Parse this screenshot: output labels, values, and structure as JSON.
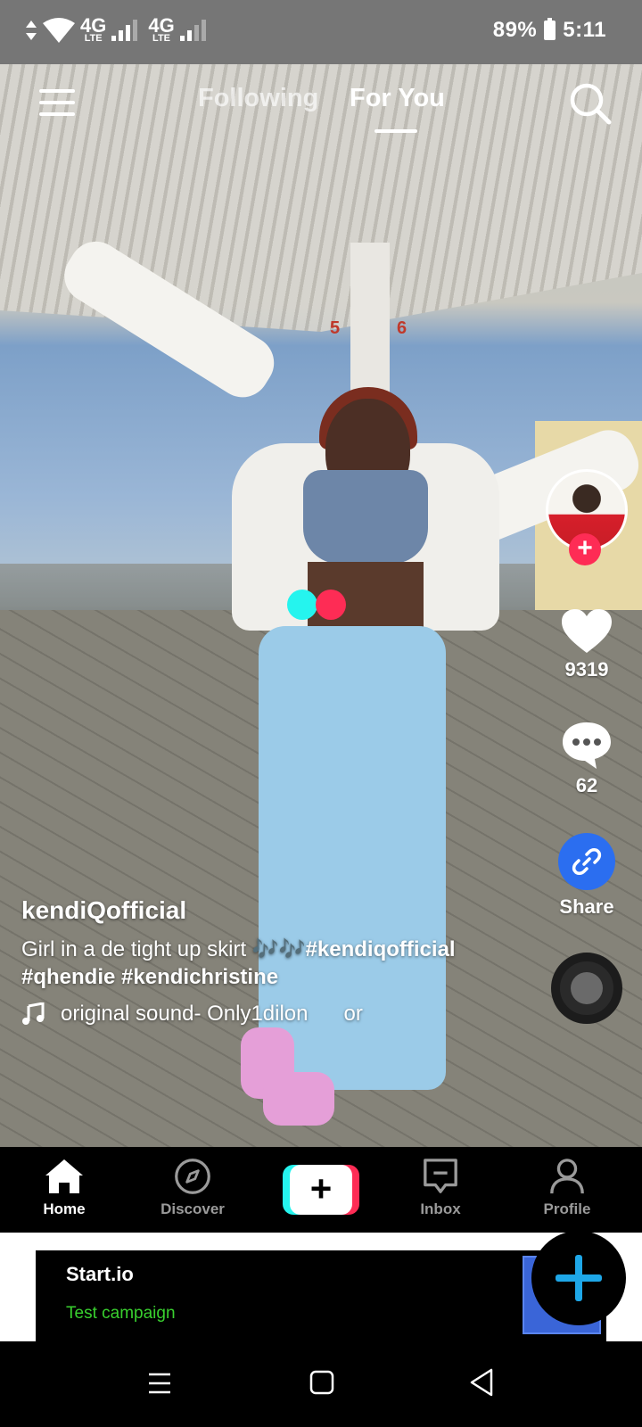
{
  "status_bar": {
    "network_1": "4G",
    "network_1_sub": "LTE",
    "network_2": "4G",
    "network_2_sub": "LTE",
    "battery": "89%",
    "time": "5:11"
  },
  "top_nav": {
    "tabs": [
      {
        "label": "Following",
        "active": false
      },
      {
        "label": "For You",
        "active": true
      }
    ],
    "menu_icon": "hamburger-icon",
    "search_icon": "search-icon"
  },
  "video": {
    "pump_labels": [
      "5",
      "6"
    ]
  },
  "side_actions": {
    "likes": "9319",
    "comments": "62",
    "share_label": "Share"
  },
  "caption": {
    "username": "kendiQofficial",
    "description_text": "Girl in a de tight up skirt 🎶🎶",
    "hashtag_1": "#kendiqofficial",
    "hashtag_2": "#qhendie",
    "hashtag_3": "#kendichristine",
    "sound": "original sound- Only1dilon",
    "sound_scroll": "or"
  },
  "bottom_nav": {
    "items": [
      {
        "label": "Home",
        "icon": "home-icon",
        "active": true
      },
      {
        "label": "Discover",
        "icon": "compass-icon",
        "active": false
      },
      {
        "label": "Inbox",
        "icon": "inbox-icon",
        "active": false
      },
      {
        "label": "Profile",
        "icon": "profile-icon",
        "active": false
      }
    ],
    "create_symbol": "+"
  },
  "ad": {
    "title": "Start.io",
    "subtitle": "Test campaign"
  },
  "colors": {
    "accent_red": "#fe2c55",
    "accent_cyan": "#25f4ee",
    "share_blue": "#2b6ef0",
    "ad_green": "#39d02f",
    "fab_plus": "#1ea7e8"
  }
}
